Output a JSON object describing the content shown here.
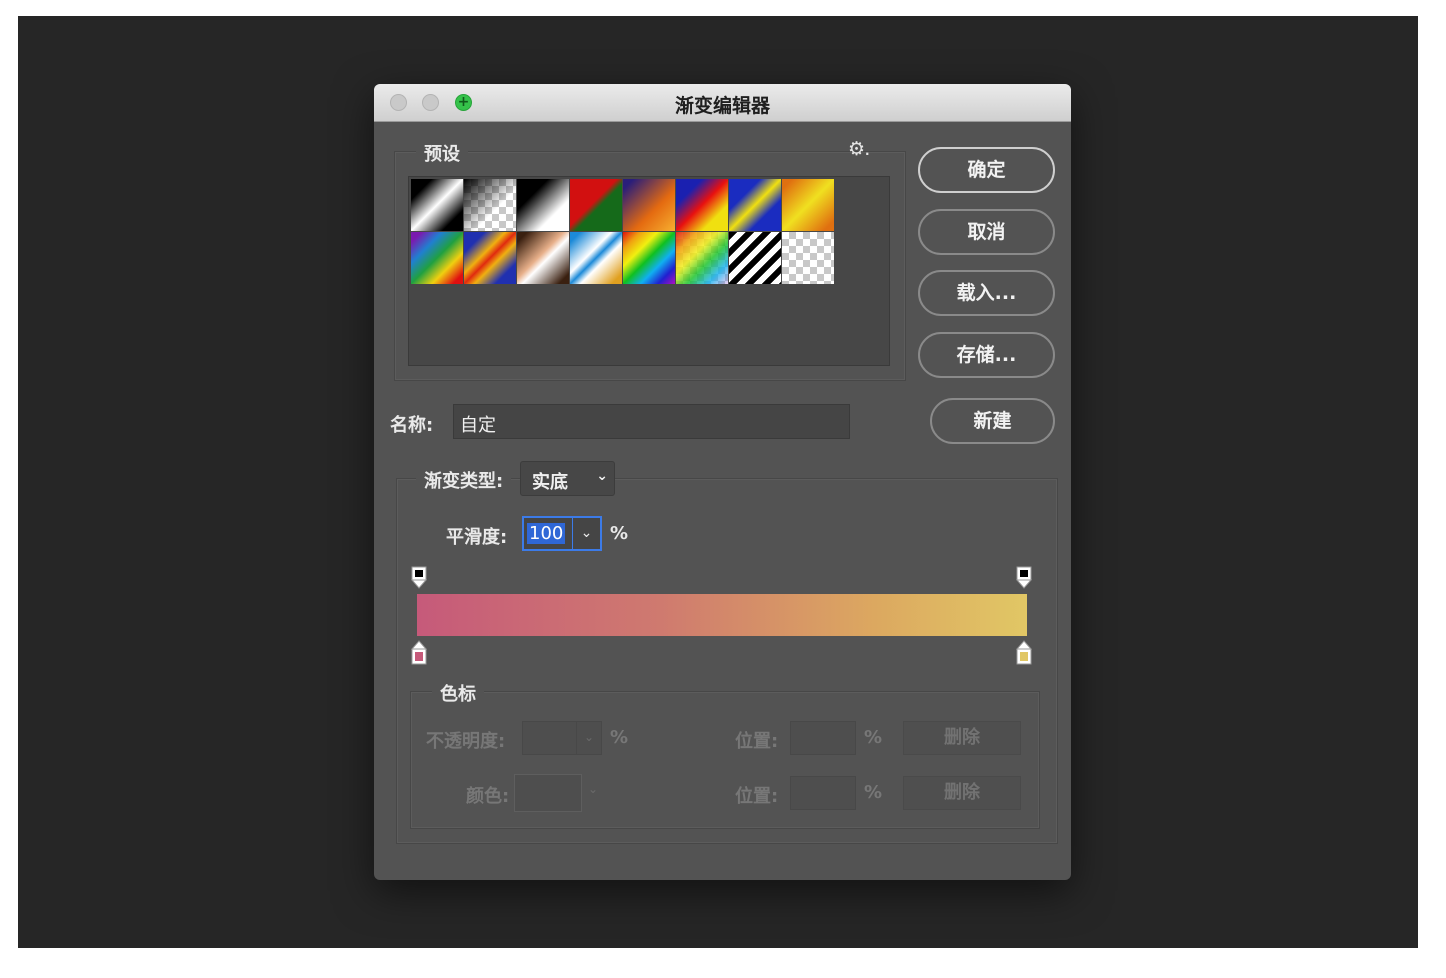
{
  "window": {
    "title": "渐变编辑器"
  },
  "presets": {
    "label": "预设",
    "gear_icon": "gear-icon",
    "swatches": [
      "linear-gradient(135deg,#000 20%,#fff 50%,#000 80%)",
      "checker-black",
      "linear-gradient(135deg,#000 30%,#fff 70%)",
      "linear-gradient(135deg,#d21010 45%,#156a1a 55%)",
      "linear-gradient(135deg,#2a1e7a 10%,#e46a10 60%,#f7b030 100%)",
      "linear-gradient(135deg,#1a20b0 25%,#e81010 50%,#f0e010 75%)",
      "linear-gradient(135deg,#1a2cc0 30%,#f0e010 50%,#1a2cc0 70%)",
      "linear-gradient(135deg,#e07010 10%,#f0e020 50%,#e07010 90%)",
      "linear-gradient(135deg,#7a1ab0 10%,#2080d0 30%,#20a040 50%,#f0d010 70%,#e01010 90%)",
      "linear-gradient(135deg,#2030b0 20%,#f0b010 40%,#e02a10 50%,#f0b010 60%,#2030b0 80%)",
      "linear-gradient(135deg,#3a2010 10%,#e8b08a 45%,#fff 55%,#3a2010 90%)",
      "linear-gradient(135deg,#1c8ad8 10%,#ffffff 40%,#1c8ad8 50%,#ffffff 60%,#e0a020 90%)",
      "linear-gradient(135deg,#e01010,#f0a010,#f0f010,#10c020,#10b0f0,#2020d0,#b010c0)",
      "rainbow-checker",
      "repeating-linear-gradient(135deg,#000 0 6px,#fff 6px 12px)",
      "checker"
    ]
  },
  "buttons": {
    "ok": "确定",
    "cancel": "取消",
    "load": "载入...",
    "save": "存储...",
    "new": "新建"
  },
  "name_field": {
    "label": "名称:",
    "value": "自定"
  },
  "gradient_type": {
    "label": "渐变类型:",
    "value": "实底"
  },
  "smoothness": {
    "label": "平滑度:",
    "value": "100",
    "unit": "%"
  },
  "gradient": {
    "start_color": "#c65a7a",
    "end_color": "#e1c765"
  },
  "color_stops": {
    "label": "色标",
    "opacity_label": "不透明度:",
    "opacity_unit": "%",
    "opacity_location_label": "位置:",
    "opacity_location_unit": "%",
    "opacity_delete": "删除",
    "color_label": "颜色:",
    "color_location_label": "位置:",
    "color_location_unit": "%",
    "color_delete": "删除"
  }
}
